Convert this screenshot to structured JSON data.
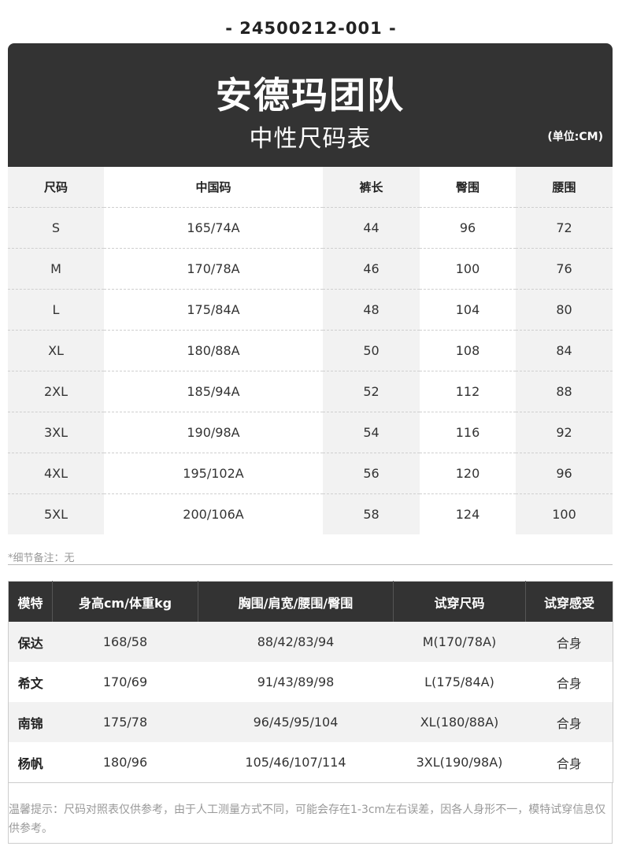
{
  "product_code": "-  24500212-001  -",
  "header": {
    "brand": "安德玛团队",
    "subtitle": "中性尺码表",
    "unit": "(单位:CM)"
  },
  "size_table": {
    "columns": [
      "尺码",
      "中国码",
      "裤长",
      "臀围",
      "腰围"
    ],
    "rows": [
      [
        "S",
        "165/74A",
        "44",
        "96",
        "72"
      ],
      [
        "M",
        "170/78A",
        "46",
        "100",
        "76"
      ],
      [
        "L",
        "175/84A",
        "48",
        "104",
        "80"
      ],
      [
        "XL",
        "180/88A",
        "50",
        "108",
        "84"
      ],
      [
        "2XL",
        "185/94A",
        "52",
        "112",
        "88"
      ],
      [
        "3XL",
        "190/98A",
        "54",
        "116",
        "92"
      ],
      [
        "4XL",
        "195/102A",
        "56",
        "120",
        "96"
      ],
      [
        "5XL",
        "200/106A",
        "58",
        "124",
        "100"
      ]
    ]
  },
  "detail_note": "*细节备注：无",
  "model_table": {
    "columns": [
      "模特",
      "身高cm/体重kg",
      "胸围/肩宽/腰围/臀围",
      "试穿尺码",
      "试穿感受"
    ],
    "rows": [
      [
        "保达",
        "168/58",
        "88/42/83/94",
        "M(170/78A)",
        "合身"
      ],
      [
        "希文",
        "170/69",
        "91/43/89/98",
        "L(175/84A)",
        "合身"
      ],
      [
        "南锦",
        "175/78",
        "96/45/95/104",
        "XL(180/88A)",
        "合身"
      ],
      [
        "杨帆",
        "180/96",
        "105/46/107/114",
        "3XL(190/98A)",
        "合身"
      ]
    ]
  },
  "tip": "温馨提示：尺码对照表仅供参考，由于人工测量方式不同，可能会存在1-3cm左右误差，因各人身形不一，模特试穿信息仅供参考。"
}
